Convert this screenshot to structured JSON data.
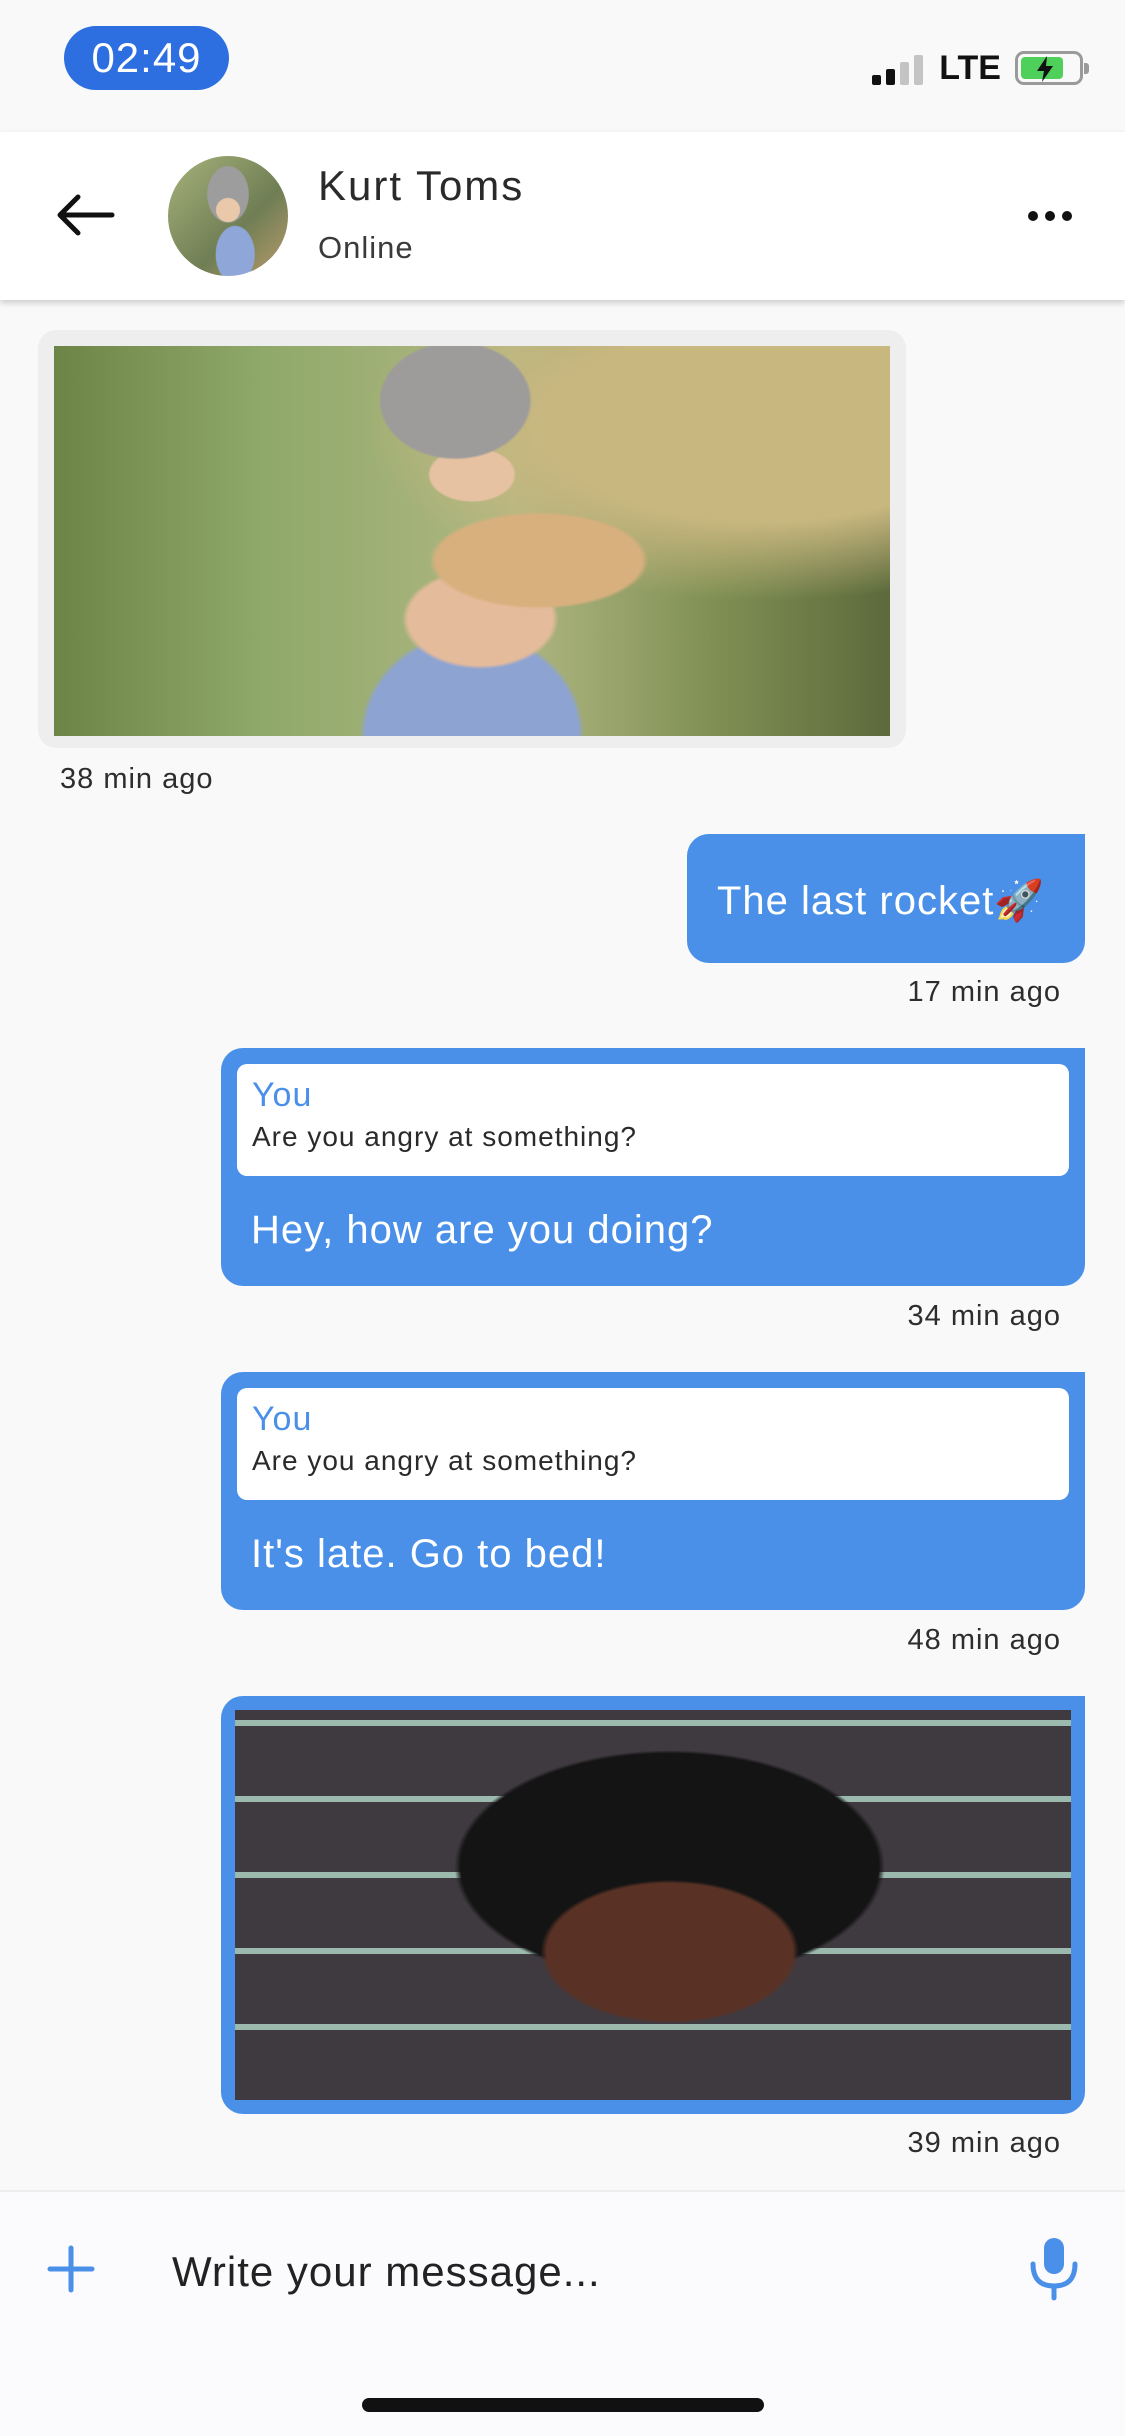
{
  "status_bar": {
    "time": "02:49",
    "network": "LTE"
  },
  "header": {
    "contact_name": "Kurt Toms",
    "contact_status": "Online",
    "icons": [
      "back-arrow-icon",
      "more-dots-icon"
    ]
  },
  "messages": [
    {
      "type": "image",
      "direction": "incoming",
      "photo": "woman in grey hat",
      "time": "38 min ago"
    },
    {
      "type": "text",
      "direction": "outgoing",
      "text": "The last rocket🚀",
      "time": "17 min ago"
    },
    {
      "type": "reply",
      "direction": "outgoing",
      "reply_author": "You",
      "reply_text": "Are you angry at something?",
      "text": "Hey, how are you doing?",
      "time": "34 min ago"
    },
    {
      "type": "reply",
      "direction": "outgoing",
      "reply_author": "You",
      "reply_text": "Are you angry at something?",
      "text": "It's late. Go to bed!",
      "time": "48 min ago"
    },
    {
      "type": "image",
      "direction": "outgoing",
      "photo": "woman portrait brick wall",
      "time": "39 min ago"
    }
  ],
  "composer": {
    "placeholder": "Write your message...",
    "icons": [
      "plus-icon",
      "microphone-icon"
    ]
  },
  "colors": {
    "accent": "#4a90e8",
    "time_pill": "#2d6fe0",
    "incoming_bubble": "#eeeeee"
  }
}
